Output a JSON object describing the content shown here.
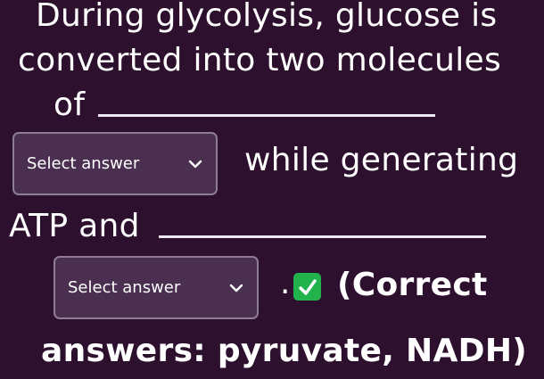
{
  "question": {
    "line1": "During glycolysis, glucose is",
    "line2": "converted into two molecules",
    "line3_prefix": "of",
    "line4_suffix": "while generating",
    "line5_prefix": "ATP and",
    "line6_period": ".",
    "line6_suffix": "(Correct",
    "line7": "answers: pyruvate, NADH)"
  },
  "dropdowns": [
    {
      "value": "Select answer",
      "icon": "chevron-down-icon"
    },
    {
      "value": "Select answer",
      "icon": "chevron-down-icon"
    }
  ],
  "status": {
    "icon": "check-mark-icon",
    "color": "#22b34c"
  },
  "colors": {
    "background": "#2d0f2e",
    "select_bg": "#4a2f50",
    "select_border": "#8e7c95",
    "text": "#ffffff"
  }
}
